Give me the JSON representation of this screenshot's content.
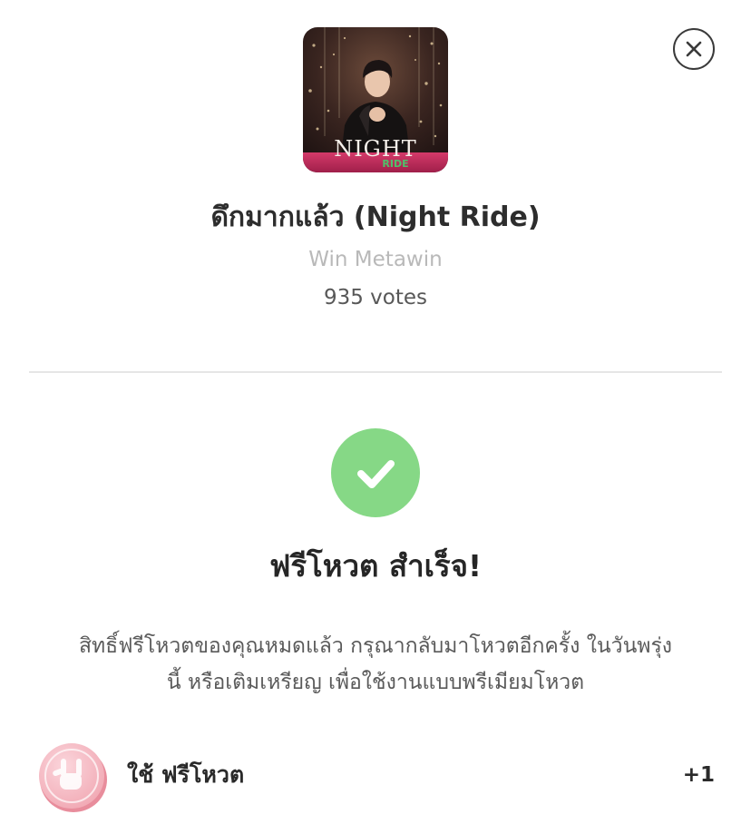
{
  "dialog": {
    "close_icon": "close-icon"
  },
  "song": {
    "cover_title_text": "NIGHT",
    "cover_subtitle_text": "RIDE",
    "title": "ดึกมากแล้ว (Night Ride)",
    "artist": "Win Metawin",
    "votes": "935 votes"
  },
  "result": {
    "icon": "check-circle-icon",
    "icon_color": "#86d886",
    "title": "ฟรีโหวต สำเร็จ!",
    "message_line1": "สิทธิ์ฟรีโหวตของคุณหมดแล้ว กรุณากลับมาโหวตอีกครั้ง ในวันพรุ่ง",
    "message_line2": "นี้ หรือเติมเหรียญ เพื่อใช้งานแบบพรีเมียมโหวต"
  },
  "free_vote": {
    "icon": "rock-hand-coin-icon",
    "coin_color": "#f5b5bf",
    "label": "ใช้ ฟรีโหวต",
    "count": "+1"
  }
}
